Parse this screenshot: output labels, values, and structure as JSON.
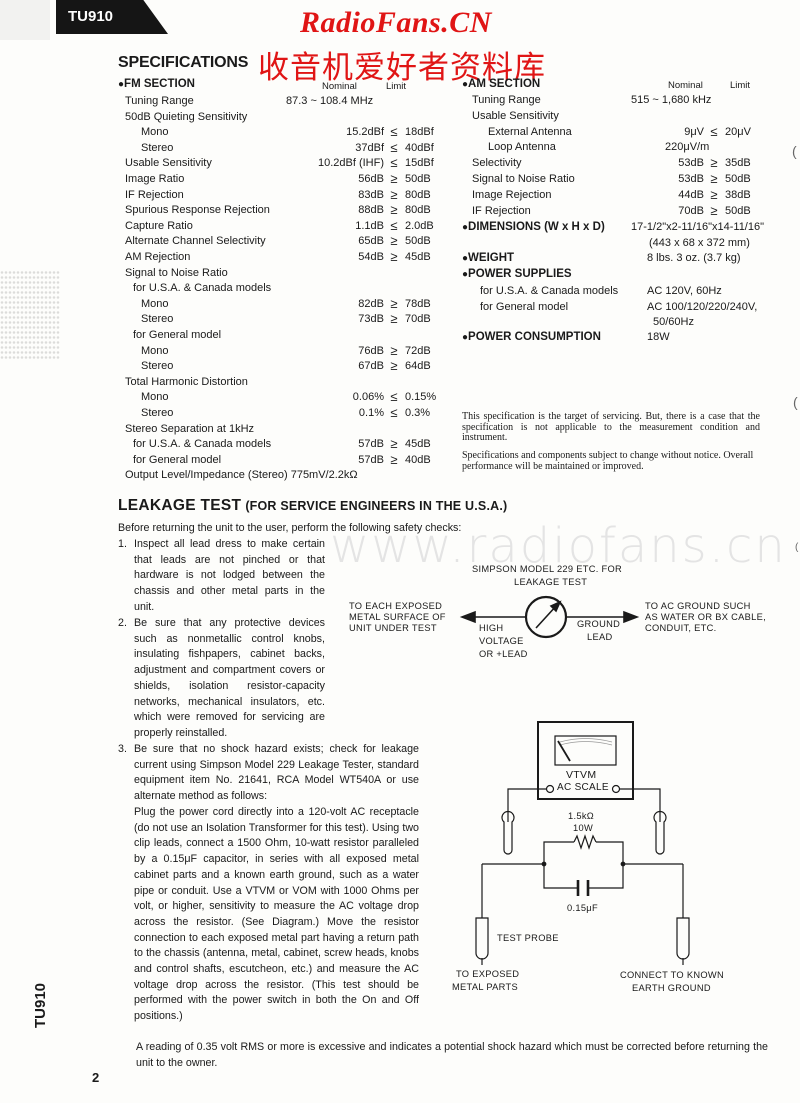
{
  "header": {
    "model_tab": "TU910",
    "watermark_en": "RadioFans.CN",
    "watermark_cn": "收音机爱好者资料库",
    "page_watermark": "www.radiofans.cn",
    "brand_color": "#e01515"
  },
  "specifications": {
    "title": "SPECIFICATIONS",
    "fm": {
      "heading": "FM SECTION",
      "col_nominal": "Nominal",
      "col_limit": "Limit",
      "rows": [
        {
          "label": "Tuning Range",
          "nominal": "87.3 ~ 108.4 MHz",
          "op": "",
          "limit": ""
        },
        {
          "label": "50dB Quieting Sensitivity",
          "nominal": "",
          "op": "",
          "limit": ""
        },
        {
          "label": "Mono",
          "nominal": "15.2dBf",
          "op": "≤",
          "limit": "18dBf"
        },
        {
          "label": "Stereo",
          "nominal": "37dBf",
          "op": "≤",
          "limit": "40dBf"
        },
        {
          "label": "Usable Sensitivity",
          "nominal": "10.2dBf (IHF)",
          "op": "≤",
          "limit": "15dBf"
        },
        {
          "label": "Image Ratio",
          "nominal": "56dB",
          "op": "≥",
          "limit": "50dB"
        },
        {
          "label": "IF Rejection",
          "nominal": "83dB",
          "op": "≥",
          "limit": "80dB"
        },
        {
          "label": "Spurious Response Rejection",
          "nominal": "88dB",
          "op": "≥",
          "limit": "80dB"
        },
        {
          "label": "Capture Ratio",
          "nominal": "1.1dB",
          "op": "≤",
          "limit": "2.0dB"
        },
        {
          "label": "Alternate Channel Selectivity",
          "nominal": "65dB",
          "op": "≥",
          "limit": "50dB"
        },
        {
          "label": "AM Rejection",
          "nominal": "54dB",
          "op": "≥",
          "limit": "45dB"
        },
        {
          "label": "Signal to Noise Ratio",
          "nominal": "",
          "op": "",
          "limit": ""
        },
        {
          "label": "for U.S.A. & Canada models",
          "nominal": "",
          "op": "",
          "limit": ""
        },
        {
          "label": "Mono",
          "nominal": "82dB",
          "op": "≥",
          "limit": "78dB"
        },
        {
          "label": "Stereo",
          "nominal": "73dB",
          "op": "≥",
          "limit": "70dB"
        },
        {
          "label": "for General model",
          "nominal": "",
          "op": "",
          "limit": ""
        },
        {
          "label": "Mono",
          "nominal": "76dB",
          "op": "≥",
          "limit": "72dB"
        },
        {
          "label": "Stereo",
          "nominal": "67dB",
          "op": "≥",
          "limit": "64dB"
        },
        {
          "label": "Total Harmonic Distortion",
          "nominal": "",
          "op": "",
          "limit": ""
        },
        {
          "label": "Mono",
          "nominal": "0.06%",
          "op": "≤",
          "limit": "0.15%"
        },
        {
          "label": "Stereo",
          "nominal": "0.1%",
          "op": "≤",
          "limit": "0.3%"
        },
        {
          "label": "Stereo Separation at 1kHz",
          "nominal": "",
          "op": "",
          "limit": ""
        },
        {
          "label": "for U.S.A. & Canada models",
          "nominal": "57dB",
          "op": "≥",
          "limit": "45dB"
        },
        {
          "label": "for General model",
          "nominal": "57dB",
          "op": "≥",
          "limit": "40dB"
        },
        {
          "label": "Output Level/Impedance (Stereo) 775mV/2.2kΩ",
          "nominal": "",
          "op": "",
          "limit": ""
        }
      ]
    },
    "am": {
      "heading": "AM SECTION",
      "col_nominal": "Nominal",
      "col_limit": "Limit",
      "rows": [
        {
          "label": "Tuning Range",
          "nominal": "515 ~ 1,680 kHz",
          "op": "",
          "limit": ""
        },
        {
          "label": "Usable Sensitivity",
          "nominal": "",
          "op": "",
          "limit": ""
        },
        {
          "label": "External Antenna",
          "nominal": "9μV",
          "op": "≤",
          "limit": "20μV"
        },
        {
          "label": "Loop Antenna",
          "nominal": "220μV/m",
          "op": "",
          "limit": ""
        },
        {
          "label": "Selectivity",
          "nominal": "53dB",
          "op": "≥",
          "limit": "35dB"
        },
        {
          "label": "Signal to Noise Ratio",
          "nominal": "53dB",
          "op": "≥",
          "limit": "50dB"
        },
        {
          "label": "Image Rejection",
          "nominal": "44dB",
          "op": "≥",
          "limit": "38dB"
        },
        {
          "label": "IF Rejection",
          "nominal": "70dB",
          "op": "≥",
          "limit": "50dB"
        }
      ]
    },
    "general": [
      {
        "label": "DIMENSIONS (W x H x D)",
        "value": "17-1/2\"x2-11/16\"x14-11/16\"",
        "value2": "(443 x 68 x 372 mm)"
      },
      {
        "label": "WEIGHT",
        "value": "8 lbs. 3 oz. (3.7 kg)"
      },
      {
        "label": "POWER SUPPLIES"
      },
      {
        "label": "for U.S.A. & Canada models",
        "value": "AC 120V, 60Hz"
      },
      {
        "label": "for General model",
        "value": "AC 100/120/220/240V,",
        "value2": "50/60Hz"
      },
      {
        "label": "POWER CONSUMPTION",
        "value": "18W"
      }
    ],
    "notes": [
      "This specification is the target of servicing. But, there is a case that the specification is not applicable to the measurement condition and instrument.",
      "Specifications and components subject to change without notice. Overall performance will be maintained or improved."
    ]
  },
  "leakage": {
    "title": "LEAKAGE TEST",
    "subtitle": "(FOR SERVICE ENGINEERS IN THE U.S.A.)",
    "intro": "Before returning the unit to the user, perform the following safety checks:",
    "steps": [
      {
        "num": "1.",
        "text": "Inspect all lead dress to make certain that leads are not pinched or that hardware is not lodged between the chassis and other metal parts in the unit."
      },
      {
        "num": "2.",
        "text": "Be sure that any protective devices such as nonmetallic control knobs, insulating fishpapers, cabinet backs, adjustment and compartment covers or shields, isolation resistor-capacity networks, mechanical insulators, etc. which were removed for servicing are properly reinstalled."
      },
      {
        "num": "3.",
        "text": "Be sure that no shock hazard exists; check for leakage current using Simpson Model 229 Leakage Tester, standard equipment item No. 21641, RCA Model WT540A or use alternate method as follows:",
        "text2": "Plug the power cord directly into a 120-volt AC receptacle (do not use an Isolation Transformer for this test). Using two clip leads, connect a 1500 Ohm, 10-watt resistor paralleled by a 0.15μF capacitor, in series with all exposed metal cabinet parts and a known earth ground, such as a water pipe or conduit. Use a VTVM or VOM with 1000 Ohms per volt, or higher, sensitivity to measure the AC voltage drop across the resistor. (See Diagram.) Move the resistor connection to each exposed metal part having a return path to the chassis (antenna, metal, cabinet, screw heads, knobs and control shafts, escutcheon, etc.) and measure the AC voltage drop across the resistor. (This test should be performed with the power switch in both the On and Off positions.)"
      }
    ],
    "conclusion": "A reading of 0.35 volt RMS or more is excessive and indicates a potential shock hazard which must be corrected before returning the unit to the owner."
  },
  "diagram1": {
    "title_line1": "SIMPSON MODEL 229 ETC. FOR",
    "title_line2": "LEAKAGE TEST",
    "left_line1": "TO EACH EXPOSED",
    "left_line2": "METAL SURFACE OF",
    "left_line3": "UNIT UNDER TEST",
    "high_line1": "HIGH",
    "high_line2": "VOLTAGE",
    "high_line3": "OR +LEAD",
    "ground_line1": "GROUND",
    "ground_line2": "LEAD",
    "right_line1": "TO AC GROUND SUCH",
    "right_line2": "AS WATER OR BX CABLE,",
    "right_line3": "CONDUIT, ETC."
  },
  "diagram2": {
    "meter_label": "VTVM",
    "scale_label": "AC SCALE",
    "resistor_value": "1.5kΩ",
    "resistor_power": "10W",
    "capacitor_value": "0.15μF",
    "probe_label": "TEST PROBE",
    "left_line1": "TO EXPOSED",
    "left_line2": "METAL PARTS",
    "right_line1": "CONNECT TO KNOWN",
    "right_line2": "EARTH GROUND"
  },
  "footer": {
    "model_vertical": "TU910",
    "page_number": "2"
  }
}
